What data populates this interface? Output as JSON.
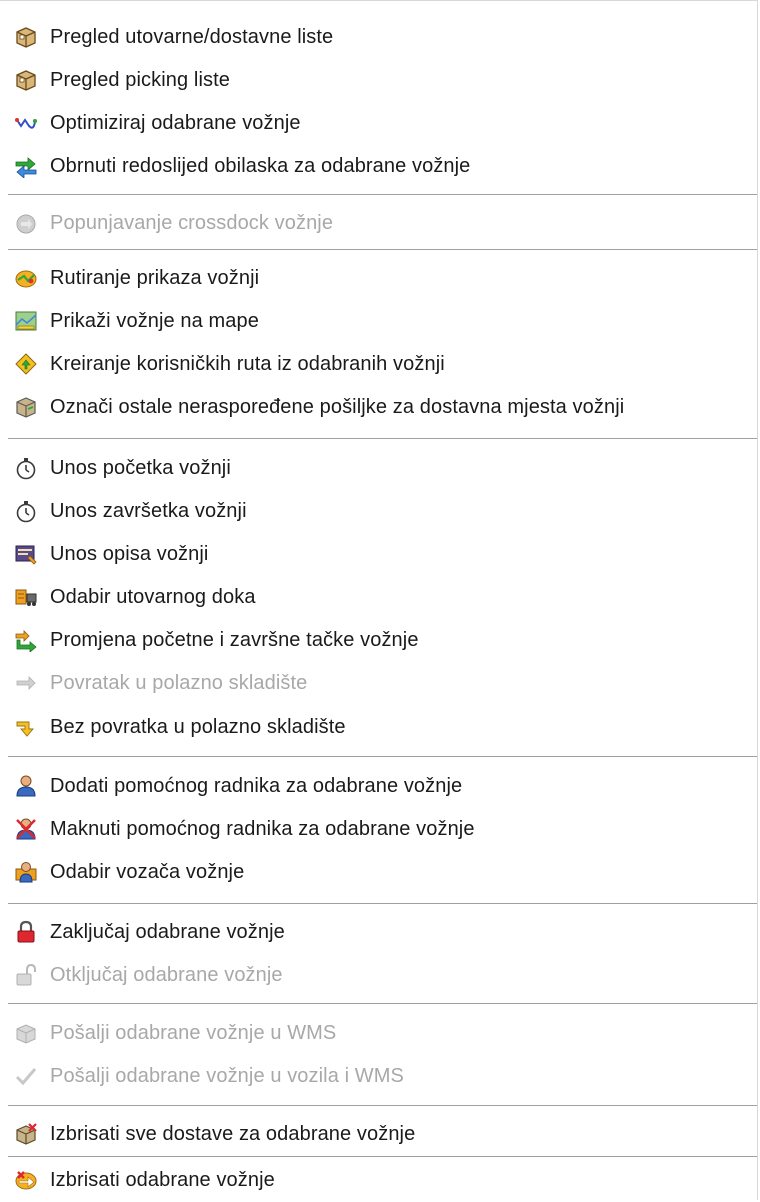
{
  "menu": {
    "items": [
      {
        "label": "Pregled utovarne/dostavne liste",
        "icon": "box-icon",
        "enabled": true
      },
      {
        "label": "Pregled picking liste",
        "icon": "box-icon",
        "enabled": true
      },
      {
        "label": "Optimiziraj odabrane vožnje",
        "icon": "route-optimize-icon",
        "enabled": true
      },
      {
        "label": "Obrnuti redoslijed obilaska za odabrane vožnje",
        "icon": "reverse-route-icon",
        "enabled": true
      },
      {
        "label": "Popunjavanje crossdock vožnje",
        "icon": "crossdock-icon",
        "enabled": false
      },
      {
        "label": "Rutiranje prikaza vožnji",
        "icon": "routing-icon",
        "enabled": true
      },
      {
        "label": "Prikaži vožnje na mape",
        "icon": "map-icon",
        "enabled": true
      },
      {
        "label": "Kreiranje korisničkih ruta iz odabranih vožnji",
        "icon": "create-route-icon",
        "enabled": true
      },
      {
        "label": "Označi ostale neraspoređene pošiljke za dostavna mjesta vožnji",
        "icon": "shipment-icon",
        "enabled": true
      },
      {
        "label": "Unos početka vožnji",
        "icon": "stopwatch-icon",
        "enabled": true
      },
      {
        "label": "Unos završetka vožnji",
        "icon": "stopwatch-icon",
        "enabled": true
      },
      {
        "label": "Unos opisa vožnji",
        "icon": "description-icon",
        "enabled": true
      },
      {
        "label": "Odabir utovarnog doka",
        "icon": "dock-icon",
        "enabled": true
      },
      {
        "label": "Promjena početne i završne tačke vožnje",
        "icon": "change-points-icon",
        "enabled": true
      },
      {
        "label": "Povratak u polazno skladište",
        "icon": "arrow-right-icon",
        "enabled": false
      },
      {
        "label": "Bez povratka u polazno skladište",
        "icon": "arrow-down-right-icon",
        "enabled": true
      },
      {
        "label": "Dodati pomoćnog radnika za odabrane vožnje",
        "icon": "person-add-icon",
        "enabled": true
      },
      {
        "label": "Maknuti pomoćnog radnika za odabrane vožnje",
        "icon": "person-remove-icon",
        "enabled": true
      },
      {
        "label": "Odabir vozača vožnje",
        "icon": "driver-icon",
        "enabled": true
      },
      {
        "label": "Zaključaj odabrane vožnje",
        "icon": "lock-icon",
        "enabled": true
      },
      {
        "label": "Otključaj odabrane vožnje",
        "icon": "unlock-icon",
        "enabled": false
      },
      {
        "label": "Pošalji odabrane vožnje u WMS",
        "icon": "send-wms-icon",
        "enabled": false
      },
      {
        "label": "Pošalji odabrane vožnje u vozila i WMS",
        "icon": "checkmark-icon",
        "enabled": false
      },
      {
        "label": "Izbrisati sve dostave za odabrane vožnje",
        "icon": "delete-deliveries-icon",
        "enabled": true
      },
      {
        "label": "Izbrisati odabrane vožnje",
        "icon": "delete-trips-icon",
        "enabled": true
      }
    ]
  },
  "colors": {
    "text": "#1a1a1a",
    "disabled_text": "#a8a8a8",
    "separator": "#a0a0a0",
    "lock_red": "#e0262e",
    "accent_orange": "#f0a020",
    "accent_green": "#2fa83a"
  }
}
